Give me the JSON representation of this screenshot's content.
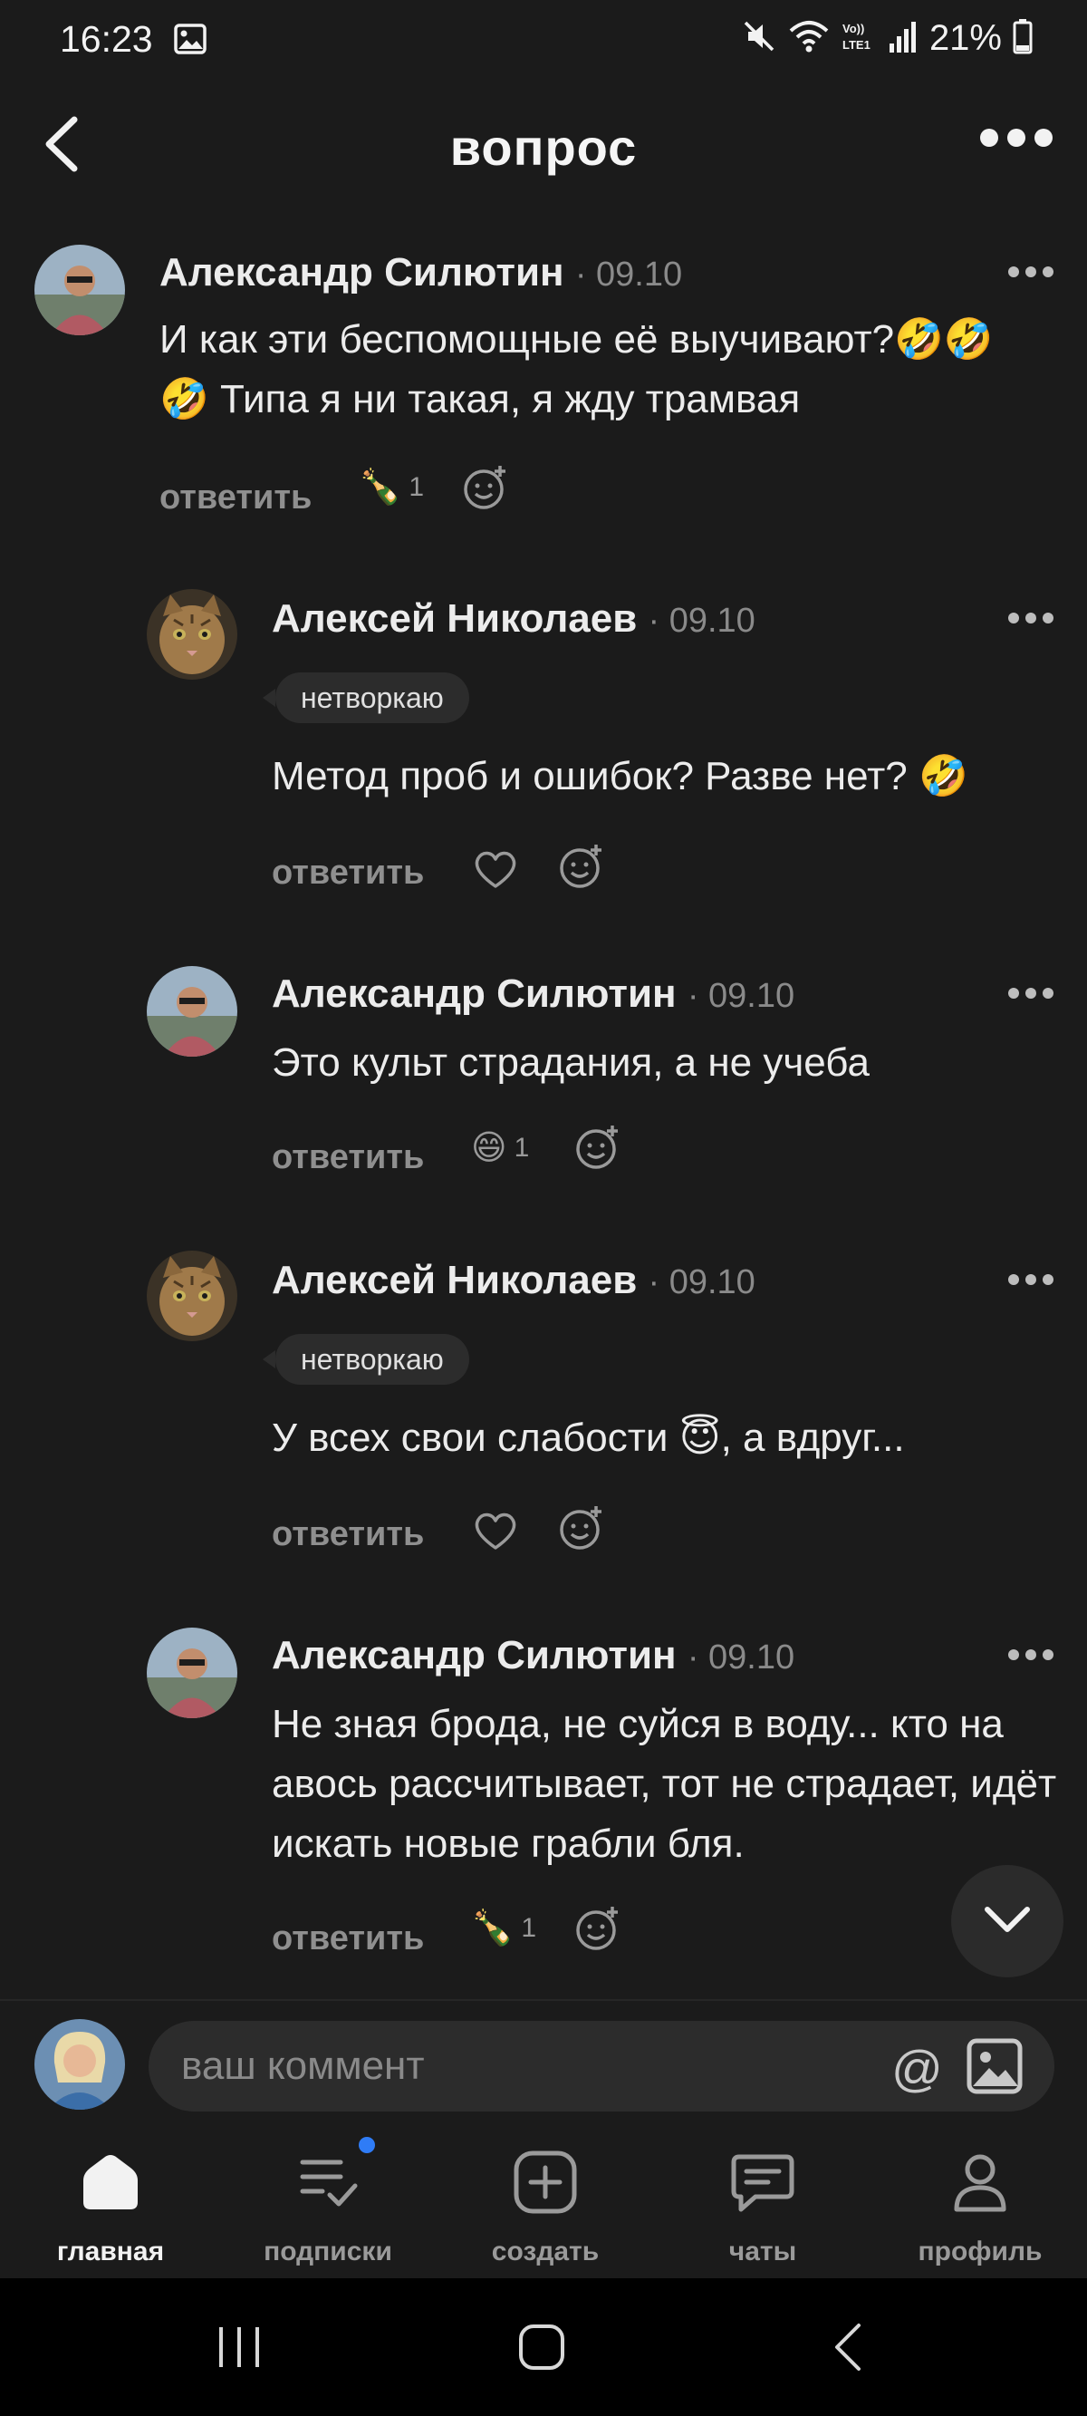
{
  "status_bar": {
    "time": "16:23",
    "battery": "21%"
  },
  "header": {
    "title": "вопрос"
  },
  "comments": [
    {
      "author": "Александр Силютин",
      "date": "· 09.10",
      "text": "И как эти беспомощные её выучивают?🤣🤣🤣 Типа я ни такая, я жду трамвая",
      "reply": "ответить",
      "reaction_emoji": "🍾",
      "reaction_count": "1"
    },
    {
      "author": "Алексей Николаев",
      "date": "· 09.10",
      "tag": "нетворкаю",
      "text": "Метод проб и ошибок? Разве нет? 🤣",
      "reply": "ответить"
    },
    {
      "author": "Александр Силютин",
      "date": "· 09.10",
      "text": "Это культ страдания, а не учеба",
      "reply": "ответить",
      "reaction_emoji": "😄",
      "reaction_count": "1"
    },
    {
      "author": "Алексей Николаев",
      "date": "· 09.10",
      "tag": "нетворкаю",
      "text": "У всех свои слабости 😇, а вдруг...",
      "reply": "ответить"
    },
    {
      "author": "Александр Силютин",
      "date": "· 09.10",
      "text": "Не зная брода, не суйся в воду...  кто на авось рассчитывает, тот не страдает, идёт искать новые грабли бля.",
      "reply": "ответить",
      "reaction_emoji": "🍾",
      "reaction_count": "1"
    }
  ],
  "composer": {
    "placeholder": "ваш коммент",
    "at_symbol": "@"
  },
  "tabs": [
    {
      "label": "главная",
      "icon": "home-icon",
      "active": true
    },
    {
      "label": "подписки",
      "icon": "subscriptions-icon",
      "active": false
    },
    {
      "label": "создать",
      "icon": "create-icon",
      "active": false
    },
    {
      "label": "чаты",
      "icon": "chat-icon",
      "active": false
    },
    {
      "label": "профиль",
      "icon": "profile-icon",
      "active": false
    }
  ],
  "colors": {
    "background": "#1b1b1b",
    "text": "#ececec",
    "muted": "#8f8f8f",
    "badge": "#2f7cf6"
  }
}
